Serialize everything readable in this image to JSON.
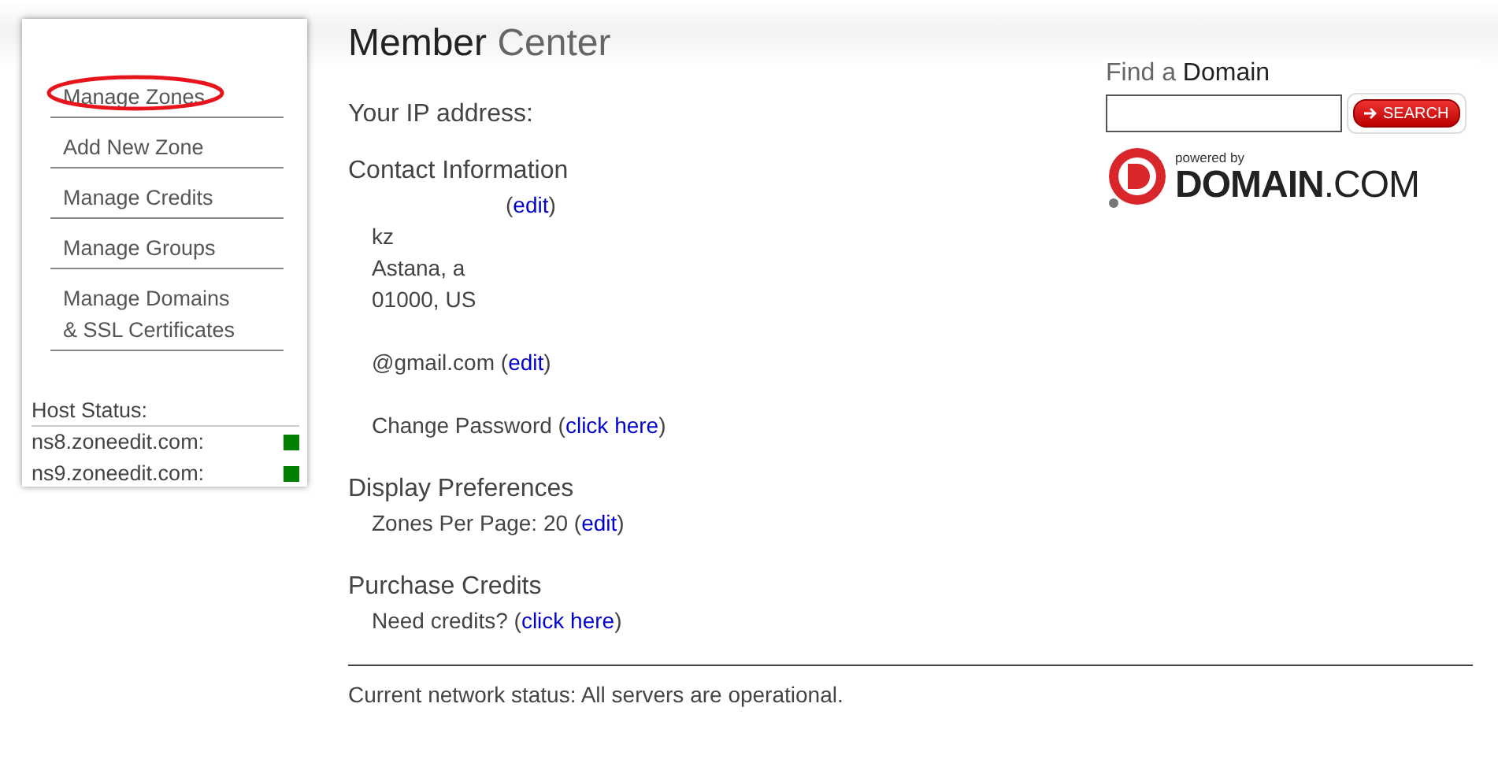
{
  "sidebar": {
    "items": [
      {
        "label": "Manage Zones",
        "highlighted": true
      },
      {
        "label": "Add New Zone",
        "highlighted": false
      },
      {
        "label": "Manage Credits",
        "highlighted": false
      },
      {
        "label": "Manage Groups",
        "highlighted": false
      },
      {
        "label": "Manage Domains\n& SSL Certificates",
        "highlighted": false
      }
    ],
    "host_status": {
      "heading": "Host Status:",
      "hosts": [
        {
          "name": "ns8.zoneedit.com:",
          "color": "#008000"
        },
        {
          "name": "ns9.zoneedit.com:",
          "color": "#008000"
        }
      ]
    }
  },
  "title": "Member **Center**",
  "ip_label": "Your IP address:",
  "sections": [
    {
      "heading": "Contact Information",
      "blocks": [
        [
          {
            "link": "edit",
            "before": "(",
            "after": ")"
          },
          {
            "text": "kz"
          },
          {
            "text": "Astana, a"
          },
          {
            "text": "01000, US"
          }
        ],
        [
          {
            "text": "@gmail.com",
            "link": "edit",
            "before": " (",
            "after": ")"
          }
        ],
        [
          {
            "text": "Change Password",
            "link": "click here",
            "before": " (",
            "after": ")"
          }
        ]
      ]
    },
    {
      "heading": "Display Preferences",
      "blocks": [
        [
          {
            "text": "Zones Per Page: 20",
            "link": "edit",
            "before": " (",
            "after": ")"
          }
        ]
      ]
    },
    {
      "heading": "Purchase Credits",
      "blocks": [
        [
          {
            "text": "Need credits?",
            "link": "click here",
            "before": " (",
            "after": ")"
          }
        ]
      ]
    }
  ],
  "footer": "Current network status: All servers are operational.",
  "domain_search": {
    "label": "Find a **Domain**",
    "button": "SEARCH",
    "tagline": "powered by",
    "brand": "**DOMAIN**.COM"
  }
}
